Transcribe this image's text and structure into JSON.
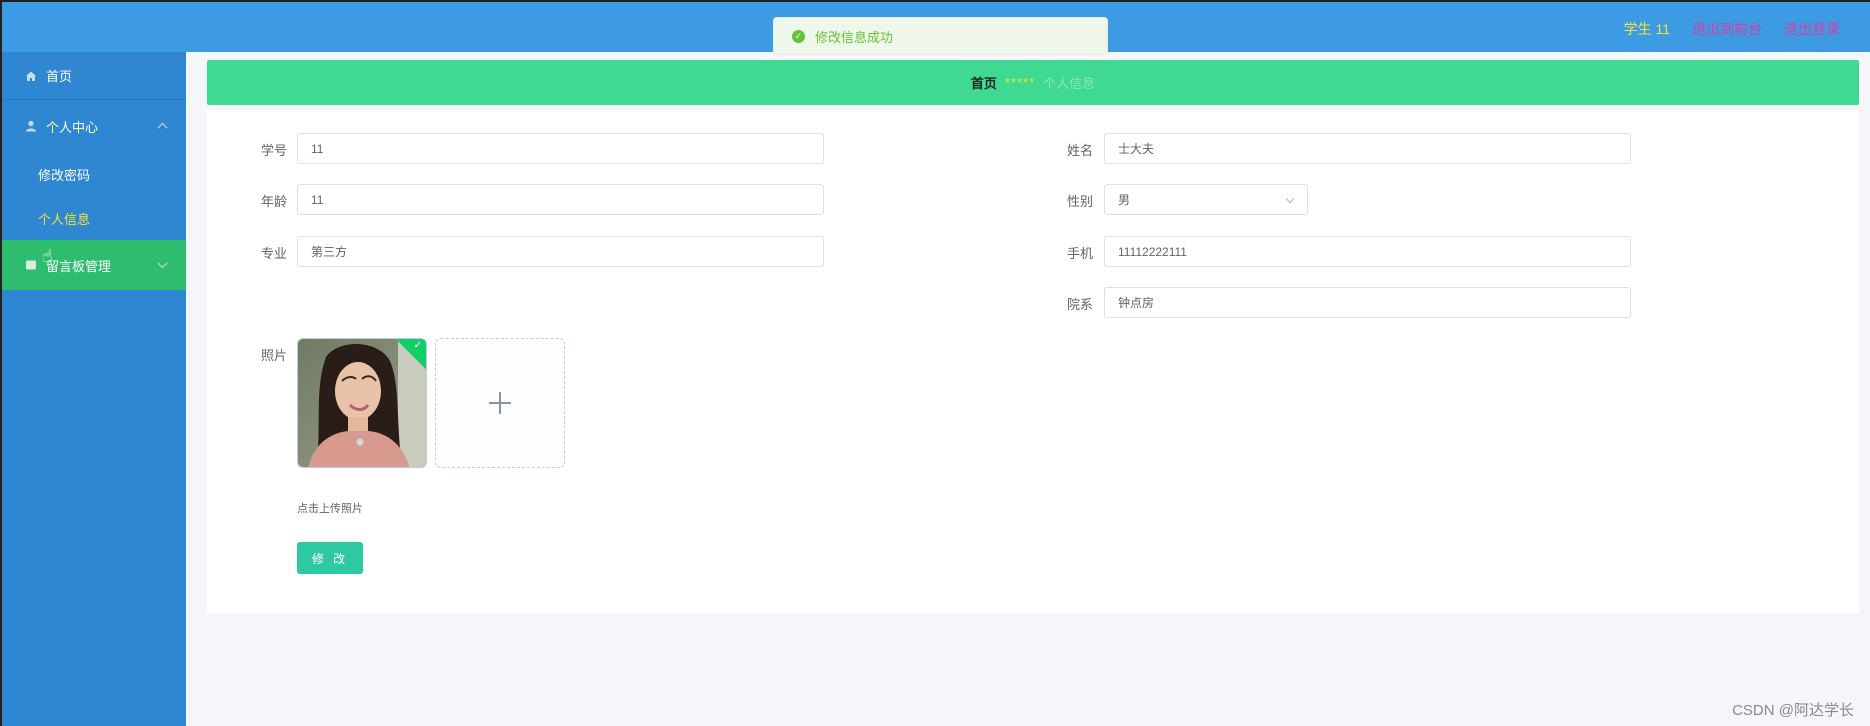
{
  "header": {
    "user_label": "学生 11",
    "front_link": "退出到前台",
    "logout_link": "退出登录"
  },
  "toast": {
    "message": "修改信息成功"
  },
  "sidebar": {
    "home": "首页",
    "personal_center": "个人中心",
    "change_password": "修改密码",
    "personal_info": "个人信息",
    "message_board": "留言板管理"
  },
  "breadcrumb": {
    "home": "首页",
    "separator": "*****",
    "current": "个人信息"
  },
  "form": {
    "student_no_label": "学号",
    "student_no": "11",
    "name_label": "姓名",
    "name": "士大夫",
    "age_label": "年龄",
    "age": "11",
    "gender_label": "性别",
    "gender": "男",
    "major_label": "专业",
    "major": "第三方",
    "phone_label": "手机",
    "phone": "11112222111",
    "department_label": "院系",
    "department": "钟点房",
    "photo_label": "照片",
    "upload_tip": "点击上传照片",
    "submit_label": "修 改"
  },
  "watermark": "CSDN @阿达学长",
  "colors": {
    "header_bg": "#3d9be3",
    "sidebar_bg": "#2f87d2",
    "active_menu_bg": "#2ebc6f",
    "breadcrumb_bg": "#3fd991",
    "submit_bg": "#2fc8a4",
    "highlight_yellow": "#f4e13b",
    "link_pink": "#d33fa6"
  }
}
